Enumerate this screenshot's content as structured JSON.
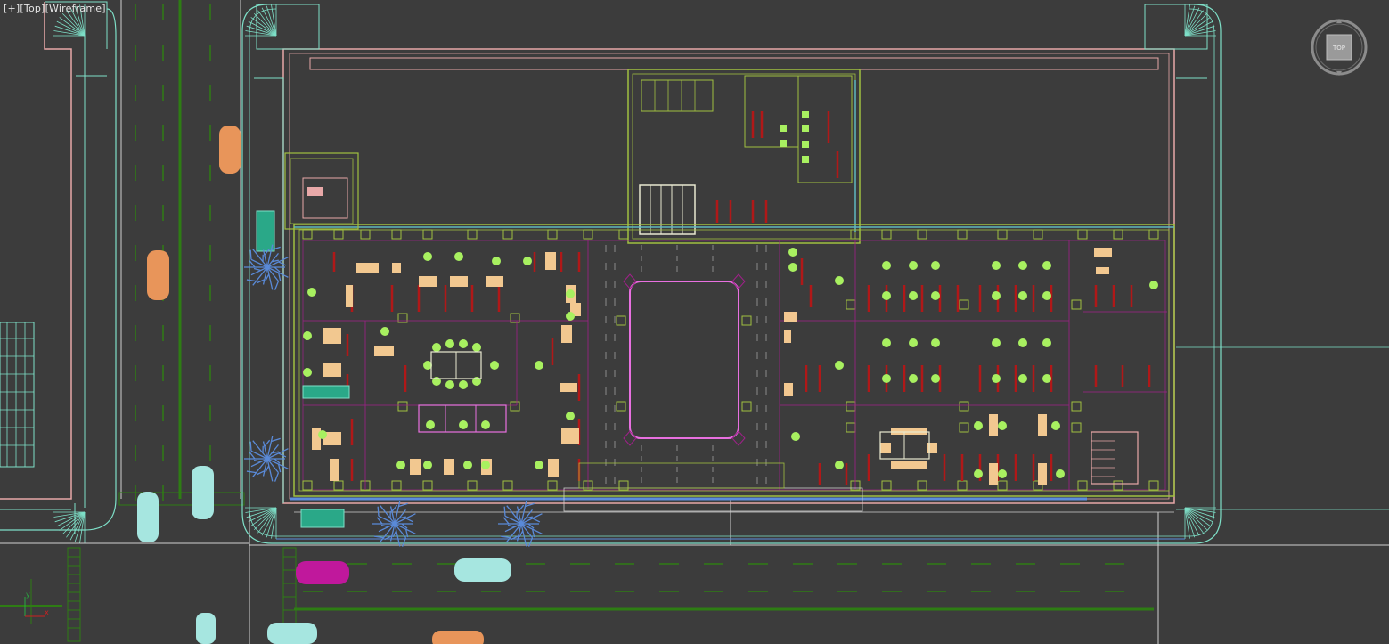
{
  "viewport": {
    "label_parts": [
      "[+]",
      "[Top]",
      "[Wireframe]"
    ],
    "viewcube_face": "TOP"
  },
  "colors": {
    "background": "#3c3c3c",
    "road_dash": "#2e7d14",
    "curb": "#7ee0c8",
    "sidewalk": "#e8a8a8",
    "building_outline": "#a0c040",
    "interior_lines": "#a0208a",
    "furniture_red": "#b01818",
    "furniture_tan": "#f2c890",
    "plants": "#a8f060",
    "atrium": "#e870e0",
    "trees": "#5a8ad8",
    "car_orange": "#e8955a",
    "car_cyan": "#a6e6e0",
    "car_magenta": "#c0189c"
  },
  "axis": {
    "x_label": "x",
    "y_label": "y"
  }
}
